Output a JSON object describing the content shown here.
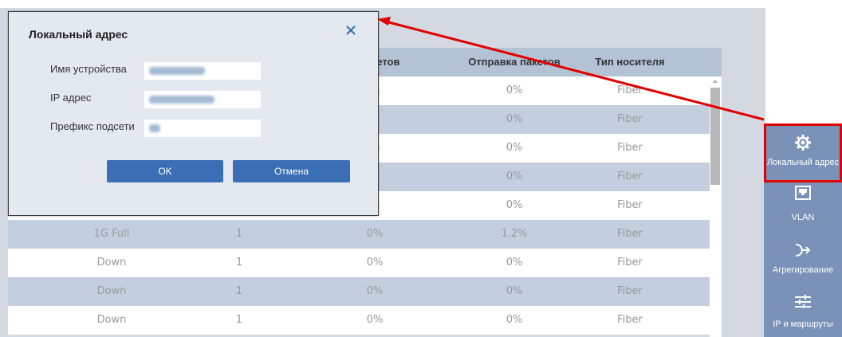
{
  "dialog": {
    "title": "Локальный адрес",
    "close_icon": "close-icon",
    "fields": [
      {
        "label": "Имя устройства",
        "value": ""
      },
      {
        "label": "IP адрес",
        "value": ""
      },
      {
        "label": "Префикс подсети",
        "value": ""
      }
    ],
    "ok_label": "OK",
    "cancel_label": "Отмена"
  },
  "table": {
    "headers": [
      "акетов",
      "Отправка пакетов",
      "Тип носителя"
    ],
    "rows": [
      {
        "status": "",
        "count": "",
        "recv": "%",
        "send": "0%",
        "media": "Fiber"
      },
      {
        "status": "",
        "count": "",
        "recv": "%",
        "send": "0%",
        "media": "Fiber"
      },
      {
        "status": "",
        "count": "",
        "recv": "%",
        "send": "0%",
        "media": "Fiber"
      },
      {
        "status": "",
        "count": "",
        "recv": "%",
        "send": "0%",
        "media": "Fiber"
      },
      {
        "status": "",
        "count": "",
        "recv": "%",
        "send": "0%",
        "media": "Fiber"
      },
      {
        "status": "1G Full",
        "count": "1",
        "recv": "0%",
        "send": "1.2%",
        "media": "Fiber"
      },
      {
        "status": "Down",
        "count": "1",
        "recv": "0%",
        "send": "0%",
        "media": "Fiber"
      },
      {
        "status": "Down",
        "count": "1",
        "recv": "0%",
        "send": "0%",
        "media": "Fiber"
      },
      {
        "status": "Down",
        "count": "1",
        "recv": "0%",
        "send": "0%",
        "media": "Fiber"
      }
    ]
  },
  "nav": {
    "items": [
      {
        "label": "Локальный адрес",
        "icon": "gear-icon",
        "active": true
      },
      {
        "label": "VLAN",
        "icon": "ethernet-port-icon",
        "active": false
      },
      {
        "label": "Агрегирование",
        "icon": "merge-arrow-icon",
        "active": false
      },
      {
        "label": "IP и маршруты",
        "icon": "sliders-icon",
        "active": false
      }
    ]
  },
  "colors": {
    "accent": "#3a6fb5",
    "highlight": "#e00000",
    "nav_bg": "#7a92b8"
  }
}
